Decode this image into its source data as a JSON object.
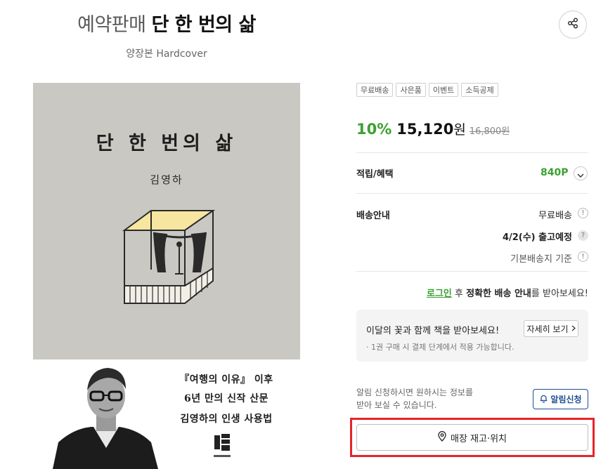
{
  "header": {
    "pre_label": "예약판매",
    "title": "단 한 번의 삶",
    "subtitle": "양장본 Hardcover"
  },
  "share": {
    "icon": "share-icon"
  },
  "cover": {
    "title": "단 한 번의 삶",
    "author": "김영하",
    "lines": [
      "『여행의 이유』 이후",
      "6년 만의 신작 산문",
      "김영하의 인생 사용법"
    ],
    "colors": {
      "top": "#c9c8c2",
      "stage_roof": "#f6e6a0"
    }
  },
  "badges": [
    "무료배송",
    "사은품",
    "이벤트",
    "소득공제"
  ],
  "price": {
    "discount": "10%",
    "amount": "15,120",
    "currency": "원",
    "original": "16,800원"
  },
  "points": {
    "label": "적립/혜택",
    "value": "840P"
  },
  "delivery": {
    "label": "배송안내",
    "free": "무료배송",
    "date": "4/2(수) 출고예정",
    "base": "기본배송지 기준"
  },
  "login_notice": {
    "link": "로그인",
    "after": " 후 ",
    "strong": "정확한 배송 안내",
    "end": "를 받아보세요!"
  },
  "gift": {
    "title": "이달의 꽃과 함께 책을 받아보세요!",
    "note": "· 1권 구매 시 결제 단계에서 적용 가능합니다.",
    "button": "자세히 보기"
  },
  "alarm": {
    "text_line1": "알림 신청하시면 원하시는 정보를",
    "text_line2": "받아 보실 수 있습니다.",
    "button": "알림신청"
  },
  "store_button": "매장 재고·위치",
  "colors": {
    "accent_green": "#3aa12f",
    "alarm_blue": "#1d4f91",
    "highlight_red": "#e5252a"
  }
}
